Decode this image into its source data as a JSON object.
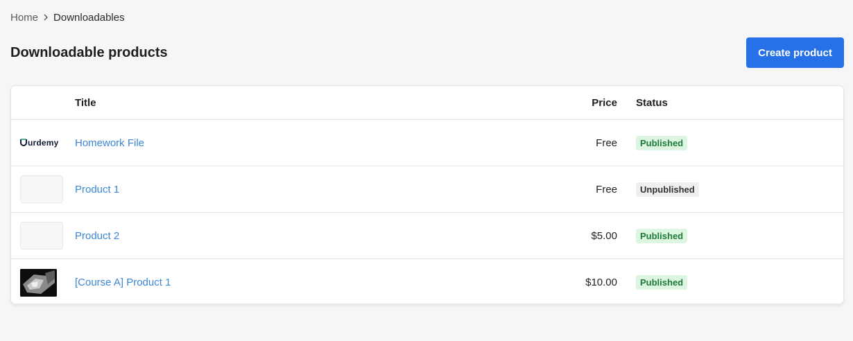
{
  "breadcrumb": {
    "home": "Home",
    "current": "Downloadables"
  },
  "header": {
    "title": "Downloadable products",
    "create_button": "Create product"
  },
  "colors": {
    "primary": "#2670e8",
    "link": "#3d86d6",
    "published_bg": "#dcf6e2",
    "published_text": "#1f7a3a",
    "unpublished_bg": "#efefef"
  },
  "table": {
    "columns": {
      "title": "Title",
      "price": "Price",
      "status": "Status"
    },
    "rows": [
      {
        "thumbnail": "logo",
        "logo_text": "urdemy",
        "title": "Homework File",
        "price": "Free",
        "status": "Published"
      },
      {
        "thumbnail": "placeholder",
        "title": "Product 1",
        "price": "Free",
        "status": "Unpublished"
      },
      {
        "thumbnail": "placeholder",
        "title": "Product 2",
        "price": "$5.00",
        "status": "Published"
      },
      {
        "thumbnail": "photo",
        "title": "[Course A] Product 1",
        "price": "$10.00",
        "status": "Published"
      }
    ]
  }
}
